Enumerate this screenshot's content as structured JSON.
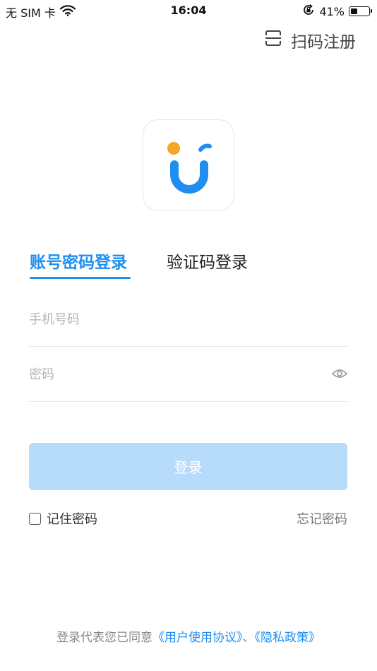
{
  "status_bar": {
    "carrier": "无 SIM 卡",
    "time": "16:04",
    "battery": "41%",
    "battery_level": 0.41,
    "icons": [
      "wifi-icon",
      "orientation-lock-icon",
      "battery-icon"
    ]
  },
  "header": {
    "scan_register_label": "扫码注册",
    "scan_icon": "scan-icon"
  },
  "logo": {
    "icon": "app-logo-u"
  },
  "tabs": [
    {
      "label": "账号密码登录",
      "active": true
    },
    {
      "label": "验证码登录",
      "active": false
    }
  ],
  "form": {
    "phone_placeholder": "手机号码",
    "phone_value": "",
    "password_placeholder": "密码",
    "password_value": "",
    "password_visibility_icon": "eye-icon"
  },
  "login_button_label": "登录",
  "remember_password": {
    "label": "记住密码",
    "checked": false
  },
  "forgot_password_label": "忘记密码",
  "agreement": {
    "prefix": "登录代表您已同意",
    "user_agreement": "《用户使用协议》",
    "separator": "、",
    "privacy_policy": "《隐私政策》"
  },
  "colors": {
    "accent": "#1e8ef0",
    "button_disabled": "#b7dbfb",
    "logo_blue": "#1e8ef0",
    "logo_orange": "#f5a623"
  }
}
